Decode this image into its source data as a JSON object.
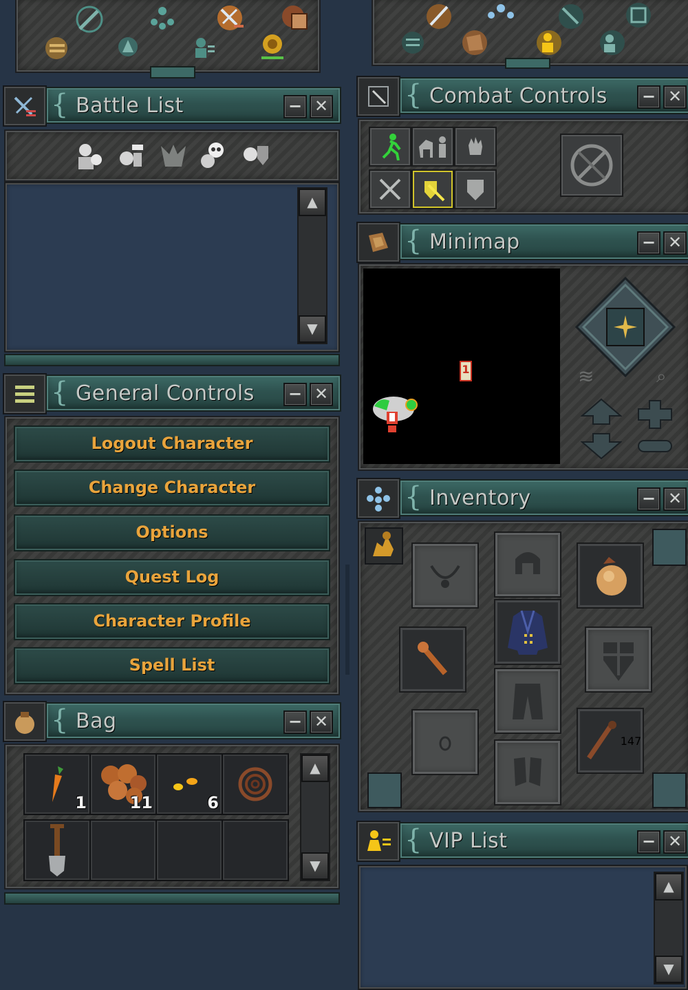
{
  "top_left_toolbar": {
    "icons": [
      "skills-icon",
      "weapon-skill-icon",
      "spell-icon",
      "combat-icon",
      "party-icon",
      "outfit-icon",
      "quest-icon",
      "chase-icon"
    ]
  },
  "battle_list": {
    "title": "Battle List",
    "minimize": "−",
    "close": "✕",
    "filters": [
      "hide-players-icon",
      "hide-npcs-icon",
      "hide-monsters-icon",
      "hide-skulls-icon",
      "hide-party-icon"
    ]
  },
  "general_controls": {
    "title": "General Controls",
    "minimize": "−",
    "close": "✕",
    "buttons": [
      "Logout Character",
      "Change Character",
      "Options",
      "Quest Log",
      "Character Profile",
      "Spell List"
    ]
  },
  "bag": {
    "title": "Bag",
    "minimize": "−",
    "close": "✕",
    "items": [
      {
        "icon": "carrot-icon",
        "count": "1"
      },
      {
        "icon": "mushroom-icon",
        "count": "11"
      },
      {
        "icon": "gold-coin-icon",
        "count": "6"
      },
      {
        "icon": "rope-icon",
        "count": ""
      },
      {
        "icon": "shovel-icon",
        "count": ""
      },
      {
        "icon": "",
        "count": ""
      },
      {
        "icon": "",
        "count": ""
      },
      {
        "icon": "",
        "count": ""
      }
    ]
  },
  "combat_controls": {
    "title": "Combat Controls",
    "minimize": "−",
    "close": "✕"
  },
  "minimap": {
    "title": "Minimap",
    "minimize": "−",
    "close": "✕",
    "marker_label": "1"
  },
  "inventory": {
    "title": "Inventory",
    "minimize": "−",
    "close": "✕",
    "ammo_count": "147"
  },
  "vip_list": {
    "title": "VIP List",
    "minimize": "−",
    "close": "✕"
  },
  "colors": {
    "background": "#263446",
    "titlebar": "#2e524f",
    "button_text": "#e9a43c",
    "title_text": "#c6c9c6"
  }
}
